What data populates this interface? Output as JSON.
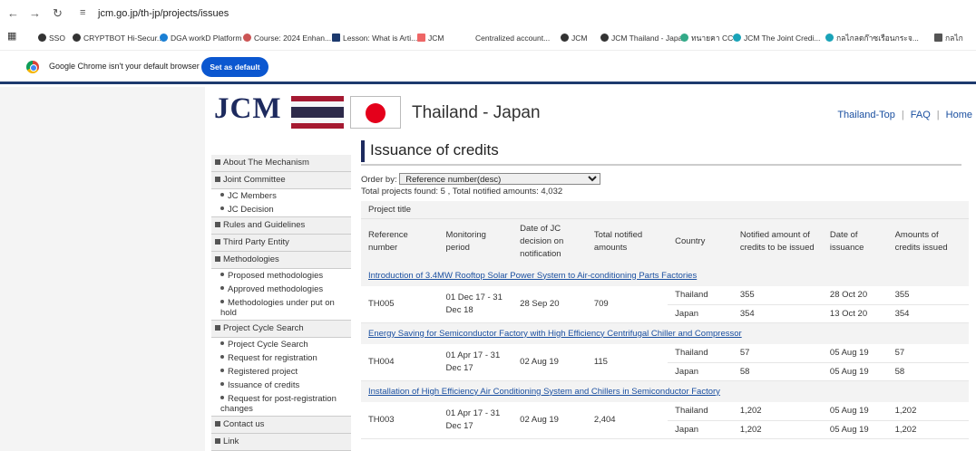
{
  "browser": {
    "url": "jcm.go.jp/th-jp/projects/issues",
    "bookmarks": [
      "SSO",
      "CRYPTBOT Hi-Secur...",
      "DGA workD Platform",
      "Course: 2024 Enhan...",
      "Lesson: What is Arti...",
      "JCM",
      "Centralized account...",
      "JCM",
      "JCM Thailand - Japan",
      "ทนายคา CC",
      "JCM The Joint Credi...",
      "กลไกลดก๊าซเรือนกระจ...",
      "กลไก"
    ],
    "infobar_message": "Google Chrome isn't your default browser",
    "infobar_button": "Set as default"
  },
  "header": {
    "logo": "JCM",
    "country_title": "Thailand - Japan",
    "links": [
      "Thailand-Top",
      "FAQ",
      "Home"
    ]
  },
  "menu": [
    {
      "label": "About The Mechanism",
      "subs": []
    },
    {
      "label": "Joint Committee",
      "subs": [
        "JC Members",
        "JC Decision"
      ]
    },
    {
      "label": "Rules and Guidelines",
      "subs": []
    },
    {
      "label": "Third Party Entity",
      "subs": []
    },
    {
      "label": "Methodologies",
      "subs": [
        "Proposed methodologies",
        "Approved methodologies",
        "Methodologies under put on hold"
      ]
    },
    {
      "label": "Project Cycle Search",
      "subs": [
        "Project Cycle Search",
        "Request for registration",
        "Registered project",
        "Issuance of credits",
        "Request for post-registration changes"
      ]
    },
    {
      "label": "Contact us",
      "subs": []
    },
    {
      "label": "Link",
      "subs": []
    }
  ],
  "main": {
    "page_title": "Issuance of credits",
    "order_label": "Order by:",
    "order_value": "Reference number(desc)",
    "total_text": "Total projects found: 5 , Total notified amounts: 4,032",
    "project_title_header": "Project title",
    "columns": [
      "Reference number",
      "Monitoring period",
      "Date of JC decision on notification",
      "Total notified amounts",
      "Country",
      "Notified amount of credits to be issued",
      "Date of issuance",
      "Amounts of credits issued"
    ],
    "projects": [
      {
        "title": "Introduction of 3.4MW Rooftop Solar Power System to Air-conditioning Parts Factories",
        "ref": "TH005",
        "period": "01 Dec 17 - 31 Dec 18",
        "jc_date": "28 Sep 20",
        "total": "709",
        "rows": [
          {
            "country": "Thailand",
            "notified": "355",
            "issue_date": "28 Oct 20",
            "issued": "355"
          },
          {
            "country": "Japan",
            "notified": "354",
            "issue_date": "13 Oct 20",
            "issued": "354"
          }
        ]
      },
      {
        "title": "Energy Saving for Semiconductor Factory with High Efficiency Centrifugal Chiller and Compressor",
        "ref": "TH004",
        "period": "01 Apr 17 - 31 Dec 17",
        "jc_date": "02 Aug 19",
        "total": "115",
        "rows": [
          {
            "country": "Thailand",
            "notified": "57",
            "issue_date": "05 Aug 19",
            "issued": "57"
          },
          {
            "country": "Japan",
            "notified": "58",
            "issue_date": "05 Aug 19",
            "issued": "58"
          }
        ]
      },
      {
        "title": "Installation of High Efficiency Air Conditioning System and Chillers in Semiconductor Factory",
        "ref": "TH003",
        "period": "01 Apr 17 - 31 Dec 17",
        "jc_date": "02 Aug 19",
        "total": "2,404",
        "rows": [
          {
            "country": "Thailand",
            "notified": "1,202",
            "issue_date": "05 Aug 19",
            "issued": "1,202"
          },
          {
            "country": "Japan",
            "notified": "1,202",
            "issue_date": "05 Aug 19",
            "issued": "1,202"
          }
        ]
      }
    ]
  }
}
